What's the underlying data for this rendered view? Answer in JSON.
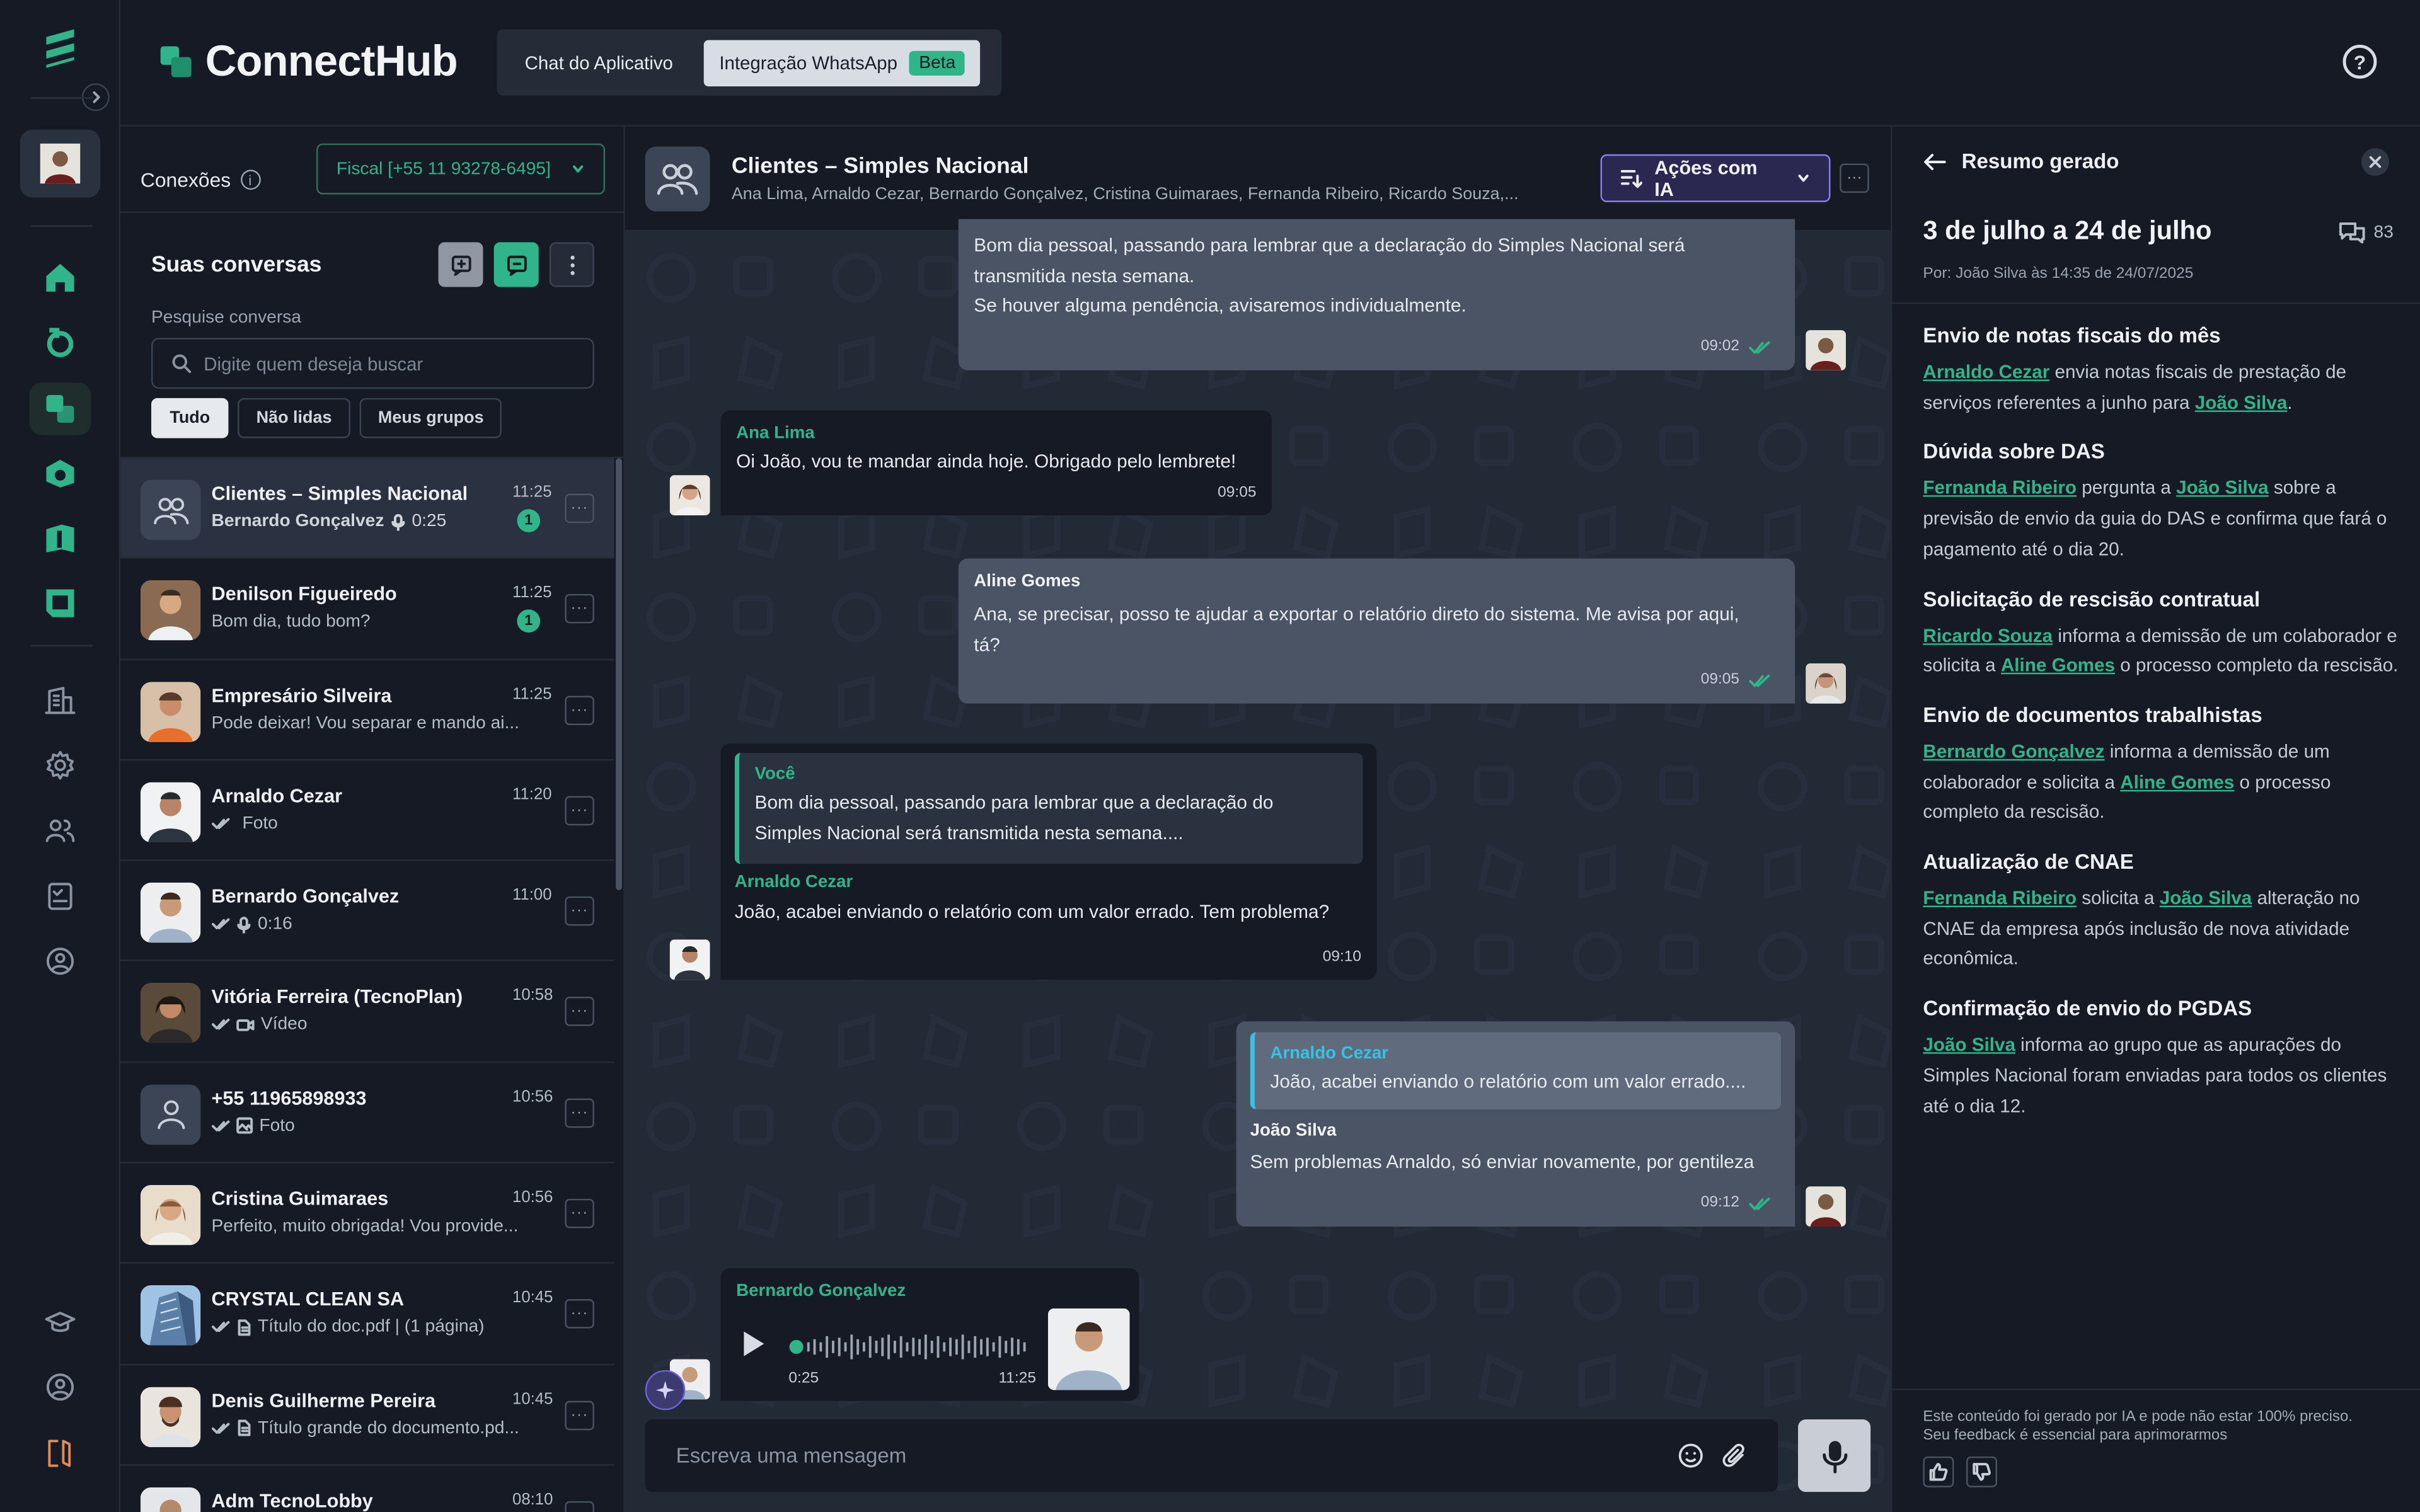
{
  "header": {
    "brand": "ConnectHub",
    "tabs": [
      "Chat do Aplicativo",
      "Integração WhatsApp"
    ],
    "beta_label": "Beta"
  },
  "connections": {
    "label": "Conexões",
    "selected": "Fiscal [+55 11 93278-6495]"
  },
  "conversations": {
    "title": "Suas conversas",
    "search_label": "Pesquise conversa",
    "search_placeholder": "Digite quem deseja buscar",
    "filters": [
      "Tudo",
      "Não lidas",
      "Meus grupos"
    ],
    "items": [
      {
        "name": "Clientes – Simples Nacional",
        "preview": "Bernardo Gonçalvez",
        "extra": "0:25",
        "time": "11:25",
        "badge": "1"
      },
      {
        "name": "Denilson Figueiredo",
        "preview": "Bom dia, tudo bom?",
        "time": "11:25",
        "badge": "1"
      },
      {
        "name": "Empresário Silveira",
        "preview": "Pode deixar! Vou separar e mando ai...",
        "time": "11:25"
      },
      {
        "name": "Arnaldo Cezar",
        "preview": "Foto",
        "time": "11:20"
      },
      {
        "name": "Bernardo Gonçalvez",
        "preview": "0:16",
        "time": "11:00"
      },
      {
        "name": "Vitória Ferreira (TecnoPlan)",
        "preview": "Vídeo",
        "time": "10:58"
      },
      {
        "name": "+55 11965898933",
        "preview": "Foto",
        "time": "10:56"
      },
      {
        "name": "Cristina Guimaraes",
        "preview": "Perfeito, muito obrigada! Vou provide...",
        "time": "10:56"
      },
      {
        "name": "CRYSTAL CLEAN SA",
        "preview": "Título do doc.pdf | (1 página)",
        "time": "10:45"
      },
      {
        "name": "Denis Guilherme Pereira",
        "preview": "Título grande do documento.pd...",
        "time": "10:45"
      },
      {
        "name": "Adm TecnoLobby",
        "preview": "",
        "time": "08:10"
      }
    ]
  },
  "chat": {
    "title": "Clientes – Simples Nacional",
    "members": "Ana Lima, Arnaldo Cezar, Bernardo Gonçalvez, Cristina Guimaraes, Fernanda Ribeiro, Ricardo Souza,...",
    "ai_button": "Ações com IA",
    "messages": {
      "m1": {
        "line1": "Bom dia pessoal, passando para lembrar que a declaração do Simples Nacional será",
        "line2": "transmitida nesta semana.",
        "line3": "Se houver alguma pendência, avisaremos individualmente.",
        "time": "09:02"
      },
      "m2": {
        "sender": "Ana Lima",
        "text": "Oi João, vou te mandar ainda hoje. Obrigado pelo lembrete!",
        "time": "09:05"
      },
      "m3": {
        "sender": "Aline Gomes",
        "line1": "Ana, se precisar, posso te ajudar a exportar o relatório direto do sistema. Me avisa por aqui,",
        "line2": "tá?",
        "time": "09:05"
      },
      "m4": {
        "quote_sender": "Você",
        "quote_line1": "Bom dia pessoal, passando para lembrar que a declaração do",
        "quote_line2": "Simples Nacional será transmitida nesta semana....",
        "sender": "Arnaldo Cezar",
        "text": "João, acabei enviando o relatório com um valor errado. Tem problema?",
        "time": "09:10"
      },
      "m5": {
        "quote_sender": "Arnaldo Cezar",
        "quote_text": "João, acabei enviando o relatório com um valor errado....",
        "sender": "João Silva",
        "text": "Sem problemas Arnaldo, só enviar novamente, por gentileza",
        "time": "09:12"
      },
      "m6": {
        "sender": "Bernardo Gonçalvez",
        "position": "0:25",
        "time": "11:25"
      }
    },
    "composer_placeholder": "Escreva uma mensagem"
  },
  "summary": {
    "header": "Resumo gerado",
    "range": "3 de julho a 24 de julho",
    "count": "83",
    "by": "Por: João Silva às 14:35 de 24/07/2025",
    "sections": [
      {
        "title": "Envio de notas fiscais do mês",
        "parts": [
          {
            "link": "Arnaldo Cezar"
          },
          {
            "text": " envia notas fiscais de prestação de serviços referentes a junho para "
          },
          {
            "link": "João Silva"
          },
          {
            "text": "."
          }
        ]
      },
      {
        "title": "Dúvida sobre DAS",
        "parts": [
          {
            "link": "Fernanda Ribeiro"
          },
          {
            "text": " pergunta a "
          },
          {
            "link": "João Silva"
          },
          {
            "text": " sobre a previsão de envio da guia do DAS e confirma que fará o pagamento até o dia 20."
          }
        ]
      },
      {
        "title": "Solicitação de rescisão contratual",
        "parts": [
          {
            "link": "Ricardo Souza"
          },
          {
            "text": " informa a demissão de um colaborador e solicita a "
          },
          {
            "link": "Aline Gomes"
          },
          {
            "text": " o processo completo da rescisão."
          }
        ]
      },
      {
        "title": "Envio de documentos trabalhistas",
        "parts": [
          {
            "link": "Bernardo Gonçalvez"
          },
          {
            "text": " informa a demissão de um colaborador e solicita a "
          },
          {
            "link": "Aline Gomes"
          },
          {
            "text": " o processo completo da rescisão."
          }
        ]
      },
      {
        "title": "Atualização de CNAE",
        "parts": [
          {
            "link": "Fernanda Ribeiro"
          },
          {
            "text": " solicita a "
          },
          {
            "link": "João Silva"
          },
          {
            "text": " alteração no CNAE da empresa após inclusão de nova atividade econômica."
          }
        ]
      },
      {
        "title": "Confirmação de envio do PGDAS",
        "parts": [
          {
            "link": "João Silva"
          },
          {
            "text": " informa ao grupo que as apurações do Simples Nacional foram enviadas para todos os clientes até o dia 12."
          }
        ]
      }
    ],
    "disclaimer_line1": "Este conteúdo foi gerado por IA e pode não estar 100% preciso.",
    "disclaimer_line2": "Seu feedback é essencial para aprimorarmos"
  },
  "colors": {
    "accent": "#2fb589",
    "ai": "#8a7df0",
    "background": "#151a24",
    "chat_bg": "#222a36"
  }
}
